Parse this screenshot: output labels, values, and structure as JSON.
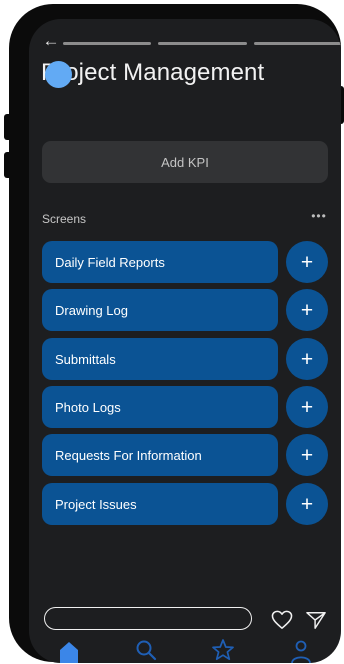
{
  "header": {
    "title": "Project Management",
    "back_icon": "back-arrow-icon"
  },
  "kpi": {
    "add_label": "Add KPI"
  },
  "screens": {
    "label": "Screens",
    "more_icon": "more-horizontal-icon",
    "items": [
      {
        "label": "Daily Field Reports"
      },
      {
        "label": "Drawing Log"
      },
      {
        "label": "Submittals"
      },
      {
        "label": "Photo Logs"
      },
      {
        "label": "Requests For Information"
      },
      {
        "label": "Project Issues"
      }
    ],
    "add_icon": "plus-icon"
  },
  "story_progress": {
    "segments": 3
  },
  "bottom_bar": {
    "reply_placeholder": "",
    "icons": [
      "heart-icon",
      "send-icon"
    ]
  },
  "tab_bar": {
    "icons": [
      "home-icon",
      "search-icon",
      "star-icon",
      "profile-icon"
    ],
    "active": "home-icon"
  },
  "colors": {
    "background": "#1d1e20",
    "row_button": "#0b5394",
    "touch_indicator": "#62aaf4",
    "active_tab": "#3b86e8",
    "inactive_tab": "#1f5fb5"
  }
}
